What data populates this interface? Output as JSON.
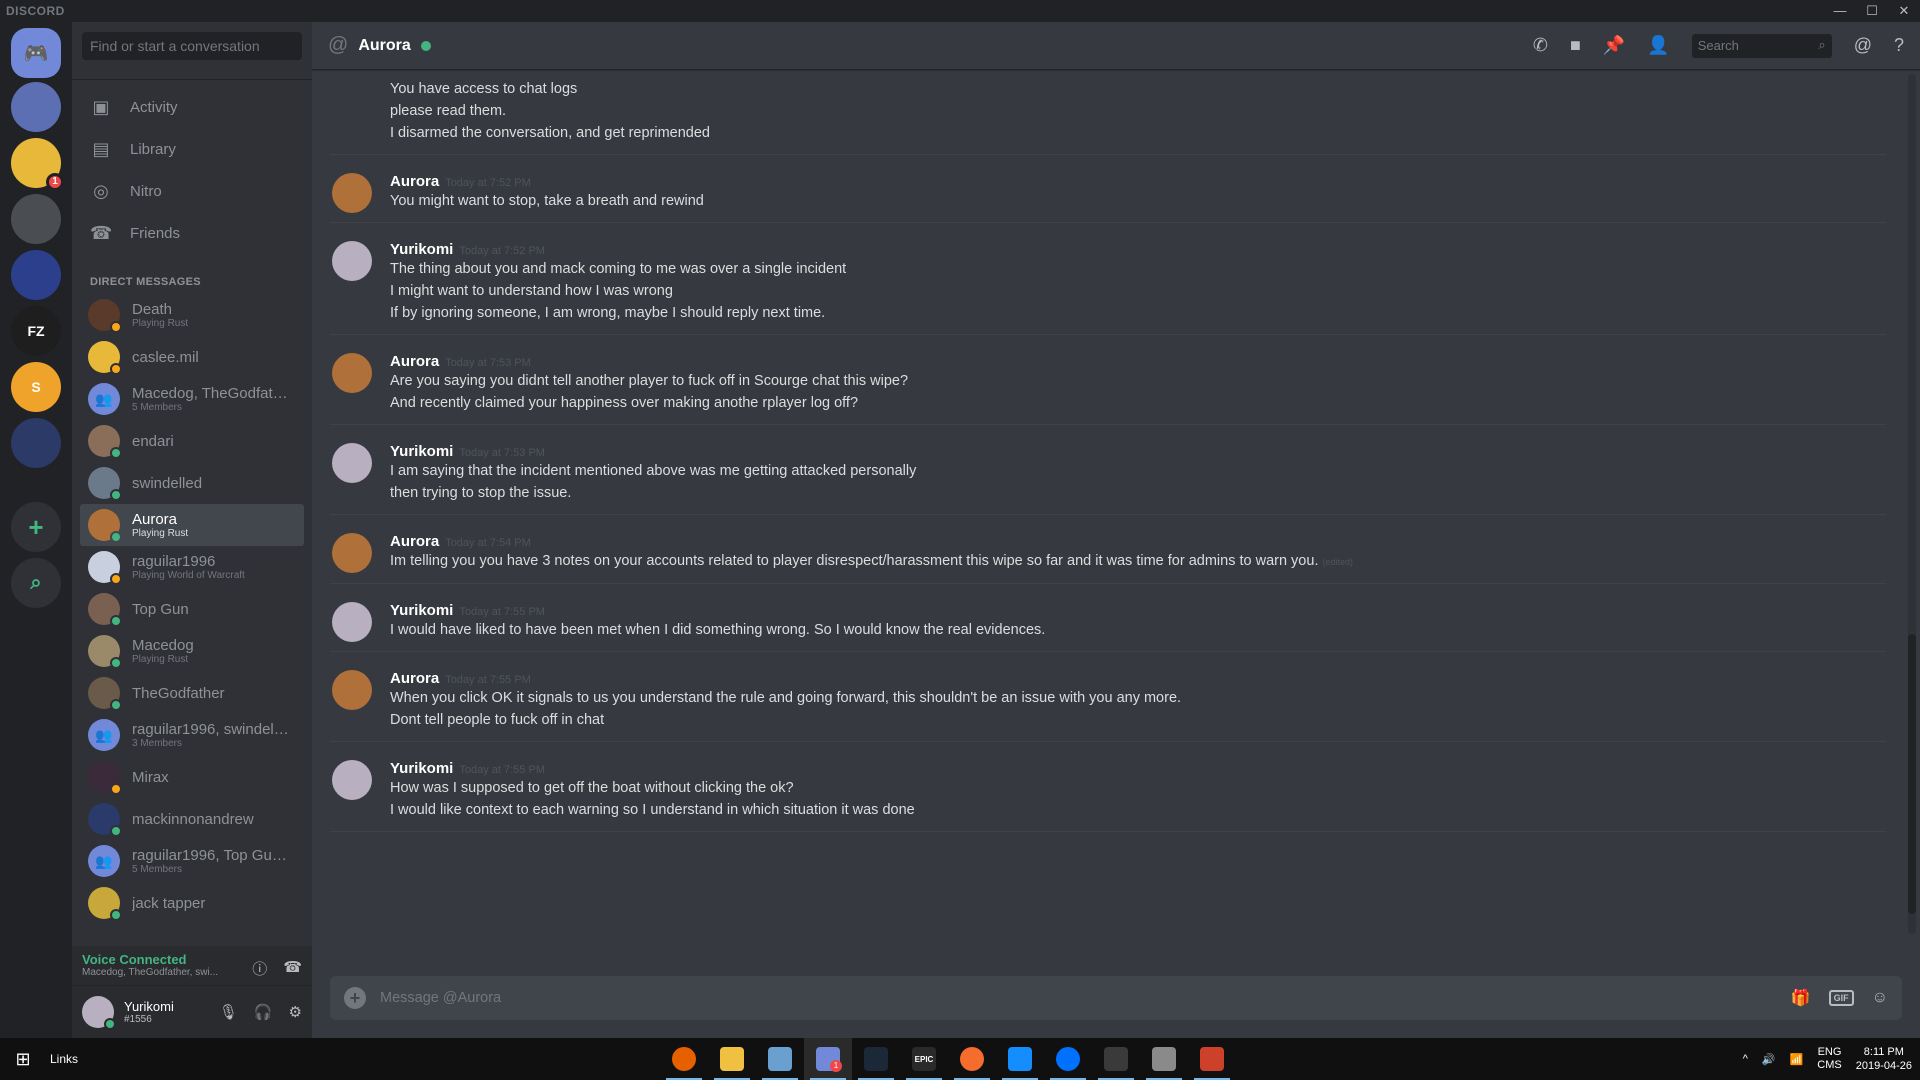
{
  "window": {
    "brand": "DISCORD"
  },
  "guilds": [
    {
      "name": "home",
      "label": "",
      "color": "#7289da"
    },
    {
      "name": "guild-1",
      "label": "",
      "color": "#5d6fb3"
    },
    {
      "name": "guild-2",
      "label": "",
      "color": "#e8b83a",
      "badge": "1"
    },
    {
      "name": "guild-3",
      "label": "",
      "color": "#4a4d52"
    },
    {
      "name": "guild-4",
      "label": "",
      "color": "#2b3f8c"
    },
    {
      "name": "guild-5",
      "label": "FZ",
      "color": "#1e1e1e"
    },
    {
      "name": "guild-6",
      "label": "S",
      "color": "#f0a32a"
    },
    {
      "name": "guild-7",
      "label": "",
      "color": "#2b3a66"
    }
  ],
  "sidebar": {
    "search_placeholder": "Find or start a conversation",
    "nav": [
      {
        "label": "Activity",
        "icon": "gamepad-icon"
      },
      {
        "label": "Library",
        "icon": "library-icon"
      },
      {
        "label": "Nitro",
        "icon": "nitro-icon"
      },
      {
        "label": "Friends",
        "icon": "friends-icon"
      }
    ],
    "dm_header": "DIRECT MESSAGES",
    "dms": [
      {
        "name": "Death",
        "sub": "Playing Rust",
        "color": "#5a3a2a",
        "status": "#faa61a"
      },
      {
        "name": "caslee.mil",
        "sub": "",
        "color": "#e8b83a",
        "status": "#faa61a"
      },
      {
        "name": "Macedog, TheGodfathe...",
        "sub": "5 Members",
        "color": "#7289da",
        "status": ""
      },
      {
        "name": "endari",
        "sub": "",
        "color": "#8a6e5a",
        "status": "#43b581"
      },
      {
        "name": "swindelled",
        "sub": "",
        "color": "#6a7a8a",
        "status": "#43b581"
      },
      {
        "name": "Aurora",
        "sub": "Playing Rust",
        "color": "#b0703a",
        "status": "#43b581",
        "active": true
      },
      {
        "name": "raguilar1996",
        "sub": "Playing World of Warcraft",
        "color": "#c8d0e0",
        "status": "#faa61a"
      },
      {
        "name": "Top Gun",
        "sub": "",
        "color": "#7a6050",
        "status": "#43b581"
      },
      {
        "name": "Macedog",
        "sub": "Playing Rust",
        "color": "#9a8a6a",
        "status": "#43b581"
      },
      {
        "name": "TheGodfather",
        "sub": "",
        "color": "#6a5a4a",
        "status": "#43b581"
      },
      {
        "name": "raguilar1996, swindelled",
        "sub": "3 Members",
        "color": "#7289da",
        "status": ""
      },
      {
        "name": "Mirax",
        "sub": "",
        "color": "#3a2a3a",
        "status": "#faa61a"
      },
      {
        "name": "mackinnonandrew",
        "sub": "",
        "color": "#2a3a6a",
        "status": "#43b581"
      },
      {
        "name": "raguilar1996, Top Gun, ...",
        "sub": "5 Members",
        "color": "#7289da",
        "status": ""
      },
      {
        "name": "jack tapper",
        "sub": "",
        "color": "#c8a83a",
        "status": "#43b581"
      }
    ],
    "voice": {
      "title": "Voice Connected",
      "sub": "Macedog, TheGodfather, swi..."
    },
    "user": {
      "name": "Yurikomi",
      "tag": "#1556"
    }
  },
  "chat": {
    "title": "Aurora",
    "search_placeholder": "Search",
    "composer_placeholder": "Message @Aurora",
    "groups": [
      {
        "author": "",
        "time": "",
        "color": "",
        "lines": [
          "You have access to chat logs",
          "please read them.",
          "I disarmed the conversation, and get reprimended"
        ]
      },
      {
        "author": "Aurora",
        "time": "Today at 7:52 PM",
        "color": "#b0703a",
        "lines": [
          "You might want to stop, take a breath and rewind"
        ]
      },
      {
        "author": "Yurikomi",
        "time": "Today at 7:52 PM",
        "color": "#b8b0c0",
        "lines": [
          "The thing about you and mack coming to me was over a single incident",
          "I might want to understand how I was wrong",
          "If by ignoring someone, I am wrong, maybe I should reply next time."
        ]
      },
      {
        "author": "Aurora",
        "time": "Today at 7:53 PM",
        "color": "#b0703a",
        "lines": [
          "Are you saying you didnt tell another player to fuck off in Scourge chat this wipe?",
          "And recently claimed your happiness over making anothe rplayer log off?"
        ]
      },
      {
        "author": "Yurikomi",
        "time": "Today at 7:53 PM",
        "color": "#b8b0c0",
        "lines": [
          "I am saying that the incident mentioned above was me getting attacked personally",
          "then trying to stop the issue."
        ]
      },
      {
        "author": "Aurora",
        "time": "Today at 7:54 PM",
        "color": "#b0703a",
        "lines": [
          "Im telling you you have 3 notes on your accounts related to player disrespect/harassment this wipe so far and it was time for admins to warn you."
        ],
        "edited": "(edited)"
      },
      {
        "author": "Yurikomi",
        "time": "Today at 7:55 PM",
        "color": "#b8b0c0",
        "lines": [
          "I would have liked to have been met when I did something wrong. So I would know the real evidences."
        ]
      },
      {
        "author": "Aurora",
        "time": "Today at 7:55 PM",
        "color": "#b0703a",
        "lines": [
          "When you click OK it signals to us you understand the rule and going forward, this shouldn't be an issue with you any more.",
          "Dont tell people to fuck off in chat"
        ]
      },
      {
        "author": "Yurikomi",
        "time": "Today at 7:55 PM",
        "color": "#b8b0c0",
        "lines": [
          "How was I supposed to get off the boat without clicking the ok?",
          "I would like context to each warning so I understand in which situation it was done"
        ]
      }
    ]
  },
  "taskbar": {
    "links": "Links",
    "apps": [
      {
        "name": "firefox",
        "label": "",
        "color": "#e66000"
      },
      {
        "name": "file-explorer",
        "label": "",
        "color": "#f0c040"
      },
      {
        "name": "notes-app",
        "label": "",
        "color": "#6aa0d0"
      },
      {
        "name": "discord",
        "label": "",
        "color": "#7289da",
        "active": true,
        "badge": "1"
      },
      {
        "name": "steam",
        "label": "",
        "color": "#1b2838"
      },
      {
        "name": "epic-games",
        "label": "EPIC",
        "color": "#2a2a2a"
      },
      {
        "name": "origin",
        "label": "",
        "color": "#f56c2d"
      },
      {
        "name": "battlenet",
        "label": "",
        "color": "#148eff"
      },
      {
        "name": "uplay",
        "label": "",
        "color": "#0070ff"
      },
      {
        "name": "droplet-app",
        "label": "",
        "color": "#3a3a3a"
      },
      {
        "name": "window-app",
        "label": "",
        "color": "#8a8a8a"
      },
      {
        "name": "rust-app",
        "label": "",
        "color": "#cd412b"
      }
    ],
    "lang": "ENG",
    "lang_sub": "CMS",
    "time": "8:11 PM",
    "date": "2019-04-26"
  }
}
